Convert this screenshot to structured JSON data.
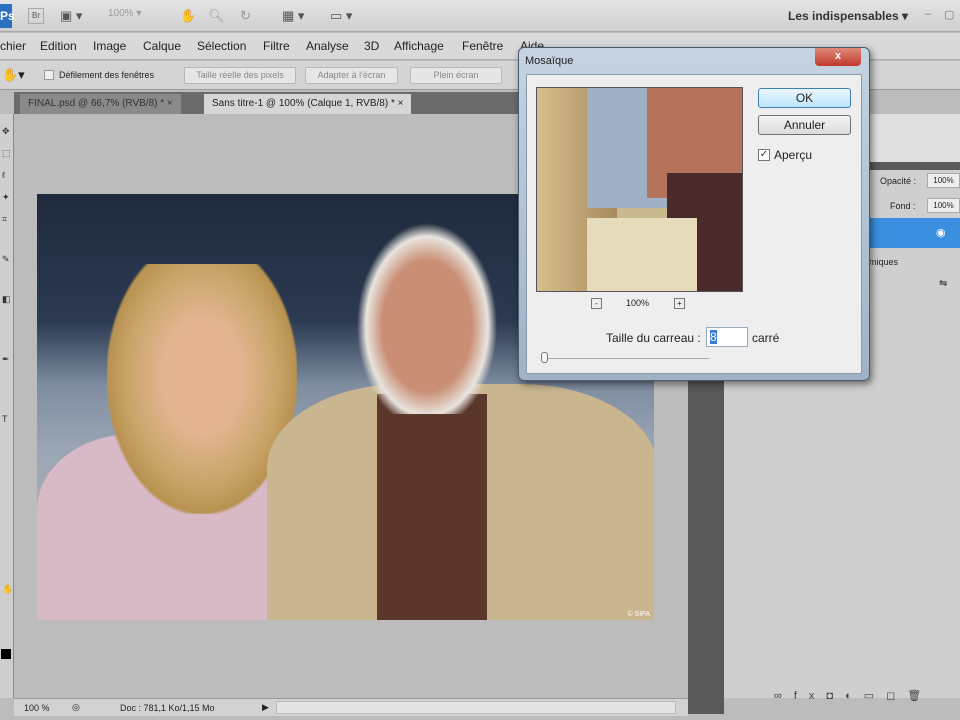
{
  "appbar": {
    "logo": "Ps",
    "bridge": "Br",
    "zoom": "100%",
    "workspace": "Les indispensables"
  },
  "menu": [
    "chier",
    "Edition",
    "Image",
    "Calque",
    "Sélection",
    "Filtre",
    "Analyse",
    "3D",
    "Affichage",
    "Fenêtre",
    "Aide"
  ],
  "options": {
    "scroll_all": "Défilement des fenêtres",
    "actual_pixels": "Taille réelle des pixels",
    "fit_screen": "Adapter à l'écran",
    "full_screen": "Plein écran"
  },
  "tabs": [
    {
      "label": "FINAL.psd @ 66,7% (RVB/8) *",
      "close": "×"
    },
    {
      "label": "Sans titre-1 @ 100% (Calque 1, RVB/8) *",
      "close": "×"
    }
  ],
  "photo": {
    "watermark": "© SIPA"
  },
  "status": {
    "zoom": "100 %",
    "doc": "Doc : 781,1 Ko/1,15 Mo"
  },
  "layers": {
    "opacity_label": "Opacité :",
    "opacity": "100%",
    "fill_label": "Fond :",
    "fill": "100%",
    "dyn": "amiques"
  },
  "dialog": {
    "title": "Mosaïque",
    "close": "x",
    "ok": "OK",
    "cancel": "Annuler",
    "preview_label": "Aperçu",
    "preview_checked": true,
    "zoom": "100%",
    "zoom_out": "-",
    "zoom_in": "+",
    "cell_size_label": "Taille du carreau :",
    "cell_size": "8",
    "unit": "carré"
  }
}
